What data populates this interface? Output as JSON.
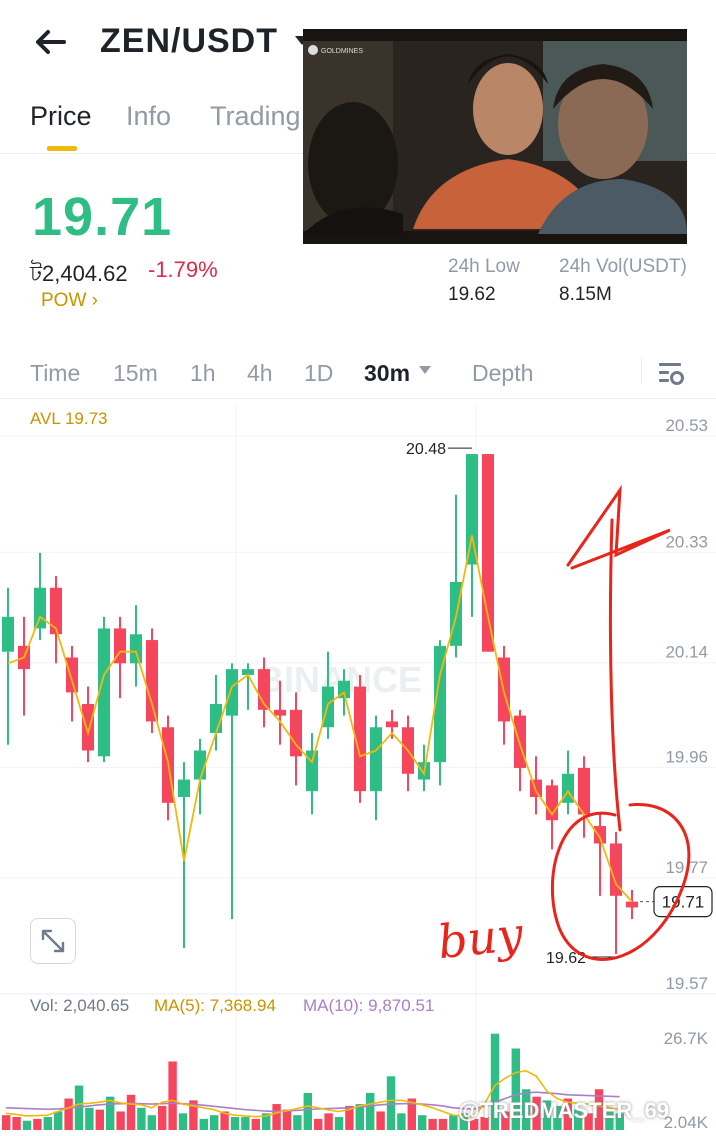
{
  "header": {
    "pair": "ZEN/USDT"
  },
  "tabs": [
    {
      "label": "Price"
    },
    {
      "label": "Info"
    },
    {
      "label": "Trading"
    }
  ],
  "ticker": {
    "last": "19.71",
    "fiat": "ট2,404.62",
    "change": "-1.79%",
    "tag": "POW ›"
  },
  "stats": {
    "low_label": "24h Low",
    "low_value": "19.62",
    "vol_label": "24h Vol(USDT)",
    "vol_value": "8.15M"
  },
  "video": {
    "logo": "GOLDMINES"
  },
  "intervals": [
    {
      "label": "Time"
    },
    {
      "label": "15m"
    },
    {
      "label": "1h"
    },
    {
      "label": "4h"
    },
    {
      "label": "1D"
    },
    {
      "label": "30m"
    },
    {
      "label": "Depth"
    }
  ],
  "chart_data": {
    "type": "candlestick",
    "avl_label": "AVL 19.73",
    "price_axis": [
      "20.53",
      "20.33",
      "20.14",
      "19.96",
      "19.77",
      "19.57"
    ],
    "price_range": [
      19.53,
      20.55
    ],
    "high_marker": "20.48",
    "low_marker": "19.62",
    "current_price": "19.71",
    "candles": [
      {
        "o": 20.14,
        "c": 20.2,
        "h": 20.25,
        "l": 19.98
      },
      {
        "o": 20.15,
        "c": 20.11,
        "h": 20.2,
        "l": 20.03
      },
      {
        "o": 20.18,
        "c": 20.25,
        "h": 20.31,
        "l": 20.16
      },
      {
        "o": 20.25,
        "c": 20.17,
        "h": 20.27,
        "l": 20.12
      },
      {
        "o": 20.13,
        "c": 20.07,
        "h": 20.15,
        "l": 20.02
      },
      {
        "o": 20.05,
        "c": 19.97,
        "h": 20.08,
        "l": 19.95
      },
      {
        "o": 19.96,
        "c": 20.18,
        "h": 20.2,
        "l": 19.95
      },
      {
        "o": 20.18,
        "c": 20.12,
        "h": 20.2,
        "l": 20.06
      },
      {
        "o": 20.12,
        "c": 20.17,
        "h": 20.22,
        "l": 20.08
      },
      {
        "o": 20.16,
        "c": 20.02,
        "h": 20.18,
        "l": 20.0
      },
      {
        "o": 20.01,
        "c": 19.88,
        "h": 20.03,
        "l": 19.85
      },
      {
        "o": 19.89,
        "c": 19.92,
        "h": 19.95,
        "l": 19.63
      },
      {
        "o": 19.92,
        "c": 19.97,
        "h": 19.99,
        "l": 19.86
      },
      {
        "o": 20.0,
        "c": 20.05,
        "h": 20.1,
        "l": 19.97
      },
      {
        "o": 20.03,
        "c": 20.11,
        "h": 20.12,
        "l": 19.68
      },
      {
        "o": 20.1,
        "c": 20.11,
        "h": 20.12,
        "l": 20.04
      },
      {
        "o": 20.11,
        "c": 20.04,
        "h": 20.13,
        "l": 20.01
      },
      {
        "o": 20.04,
        "c": 20.03,
        "h": 20.09,
        "l": 19.98
      },
      {
        "o": 20.04,
        "c": 19.96,
        "h": 20.07,
        "l": 19.91
      },
      {
        "o": 19.9,
        "c": 19.97,
        "h": 20.0,
        "l": 19.86
      },
      {
        "o": 20.01,
        "c": 20.08,
        "h": 20.14,
        "l": 19.99
      },
      {
        "o": 20.06,
        "c": 20.09,
        "h": 20.11,
        "l": 20.03
      },
      {
        "o": 20.08,
        "c": 19.9,
        "h": 20.1,
        "l": 19.88
      },
      {
        "o": 19.9,
        "c": 20.01,
        "h": 20.03,
        "l": 19.85
      },
      {
        "o": 20.02,
        "c": 20.01,
        "h": 20.04,
        "l": 19.99
      },
      {
        "o": 20.01,
        "c": 19.93,
        "h": 20.03,
        "l": 19.9
      },
      {
        "o": 19.92,
        "c": 19.95,
        "h": 19.98,
        "l": 19.9
      },
      {
        "o": 19.95,
        "c": 20.15,
        "h": 20.16,
        "l": 19.91
      },
      {
        "o": 20.15,
        "c": 20.26,
        "h": 20.41,
        "l": 20.13
      },
      {
        "o": 20.29,
        "c": 20.48,
        "h": 20.48,
        "l": 20.2
      },
      {
        "o": 20.48,
        "c": 20.14,
        "h": 20.48,
        "l": 20.14
      },
      {
        "o": 20.13,
        "c": 20.02,
        "h": 20.15,
        "l": 19.98
      },
      {
        "o": 20.03,
        "c": 19.94,
        "h": 20.04,
        "l": 19.9
      },
      {
        "o": 19.92,
        "c": 19.89,
        "h": 19.96,
        "l": 19.86
      },
      {
        "o": 19.91,
        "c": 19.85,
        "h": 19.92,
        "l": 19.8
      },
      {
        "o": 19.88,
        "c": 19.93,
        "h": 19.97,
        "l": 19.86
      },
      {
        "o": 19.94,
        "c": 19.86,
        "h": 19.96,
        "l": 19.82
      },
      {
        "o": 19.84,
        "c": 19.81,
        "h": 19.86,
        "l": 19.72
      },
      {
        "o": 19.81,
        "c": 19.72,
        "h": 19.83,
        "l": 19.62
      },
      {
        "o": 19.71,
        "c": 19.7,
        "h": 19.73,
        "l": 19.68
      }
    ],
    "avl_line": [
      20.12,
      20.13,
      20.2,
      20.18,
      20.09,
      20.0,
      20.1,
      20.14,
      20.14,
      20.05,
      19.95,
      19.78,
      19.92,
      20.0,
      20.08,
      20.1,
      20.05,
      20.02,
      19.98,
      19.95,
      20.05,
      20.07,
      19.96,
      19.97,
      20.0,
      19.97,
      19.93,
      20.1,
      20.2,
      20.34,
      20.2,
      20.07,
      19.98,
      19.9,
      19.86,
      19.9,
      19.86,
      19.82,
      19.74,
      19.71
    ],
    "volume": {
      "label": "Vol: 2,040.65",
      "ma5_label": "MA(5): 7,368.94",
      "ma10_label": "MA(10): 9,870.51",
      "axis_top": "26.7K",
      "axis_bottom": "2.04K",
      "max": 27000,
      "bars": [
        4000,
        3500,
        2500,
        3000,
        3500,
        5000,
        8500,
        12000,
        6000,
        5500,
        9000,
        5000,
        9500,
        6000,
        4000,
        6500,
        18500,
        4500,
        8000,
        3000,
        4000,
        5000,
        3500,
        3500,
        3000,
        4500,
        7000,
        5500,
        4000,
        10000,
        3000,
        4500,
        3500,
        6500,
        7000,
        10000,
        5000,
        14500,
        4500,
        8500,
        4000,
        3000,
        3000,
        4000,
        4500,
        3000,
        3500,
        26000,
        5000,
        22000,
        11000,
        9000,
        8000,
        6500,
        8500,
        5500,
        4500,
        11000,
        5000,
        4500
      ],
      "ma5": [
        4500,
        4200,
        3800,
        3900,
        4000,
        5000,
        6000,
        7000,
        7200,
        7500,
        8000,
        7300,
        7000,
        6800,
        6000,
        7500,
        8000,
        7000,
        6500,
        6000,
        5500,
        4500,
        4000,
        3800,
        3600,
        3800,
        4600,
        5200,
        5800,
        6500,
        6000,
        5400,
        5000,
        5500,
        6500,
        7000,
        7500,
        8000,
        8000,
        7500,
        6800,
        6000,
        5000,
        4000,
        3800,
        3700,
        7000,
        12000,
        14000,
        15500,
        16000,
        14500,
        10500,
        8500,
        7500,
        7200,
        7000,
        6500,
        6000,
        5500
      ],
      "ma10": [
        6000,
        5900,
        5800,
        5700,
        5600,
        5700,
        5900,
        6200,
        6500,
        6800,
        7000,
        7100,
        7200,
        7100,
        7000,
        7100,
        7200,
        7100,
        6900,
        6700,
        6400,
        6100,
        5800,
        5500,
        5300,
        5100,
        5000,
        5100,
        5300,
        5500,
        5700,
        5800,
        5900,
        6000,
        6200,
        6500,
        6800,
        7000,
        7100,
        7100,
        7000,
        6800,
        6500,
        6000,
        5800,
        5700,
        6400,
        7500,
        8500,
        9500,
        10000,
        10200,
        10000,
        9800,
        9500,
        9400,
        9300,
        9200,
        9100,
        9000
      ]
    }
  },
  "annotations": {
    "handwritten": "buy"
  },
  "watermarks": {
    "exchange": "BINANCE",
    "user": "@TREDMASTER_69"
  },
  "colors": {
    "up": "#2ebd85",
    "down": "#f6465d",
    "accent": "#f0b90b",
    "ma10": "#a97fc9",
    "annot": "#e8241b"
  }
}
